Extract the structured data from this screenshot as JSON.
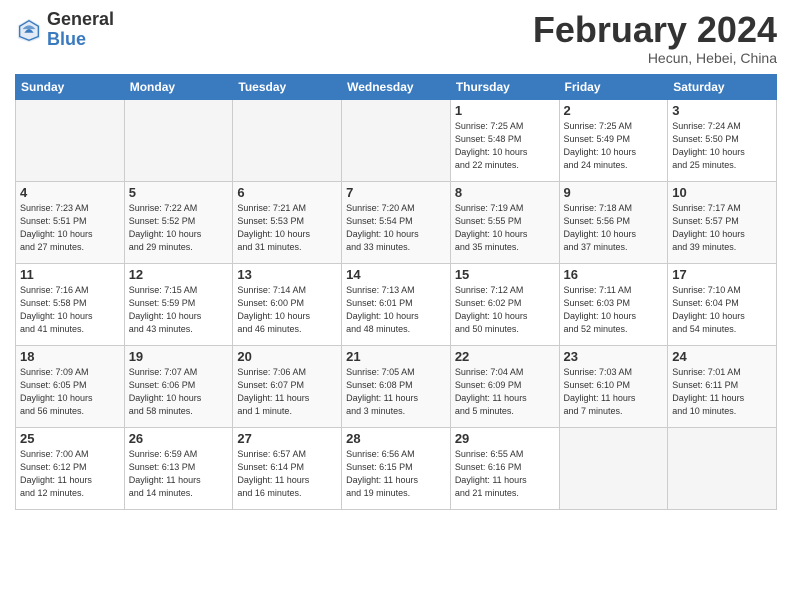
{
  "header": {
    "logo_general": "General",
    "logo_blue": "Blue",
    "title": "February 2024",
    "location": "Hecun, Hebei, China"
  },
  "days_of_week": [
    "Sunday",
    "Monday",
    "Tuesday",
    "Wednesday",
    "Thursday",
    "Friday",
    "Saturday"
  ],
  "weeks": [
    [
      {
        "num": "",
        "info": ""
      },
      {
        "num": "",
        "info": ""
      },
      {
        "num": "",
        "info": ""
      },
      {
        "num": "",
        "info": ""
      },
      {
        "num": "1",
        "info": "Sunrise: 7:25 AM\nSunset: 5:48 PM\nDaylight: 10 hours\nand 22 minutes."
      },
      {
        "num": "2",
        "info": "Sunrise: 7:25 AM\nSunset: 5:49 PM\nDaylight: 10 hours\nand 24 minutes."
      },
      {
        "num": "3",
        "info": "Sunrise: 7:24 AM\nSunset: 5:50 PM\nDaylight: 10 hours\nand 25 minutes."
      }
    ],
    [
      {
        "num": "4",
        "info": "Sunrise: 7:23 AM\nSunset: 5:51 PM\nDaylight: 10 hours\nand 27 minutes."
      },
      {
        "num": "5",
        "info": "Sunrise: 7:22 AM\nSunset: 5:52 PM\nDaylight: 10 hours\nand 29 minutes."
      },
      {
        "num": "6",
        "info": "Sunrise: 7:21 AM\nSunset: 5:53 PM\nDaylight: 10 hours\nand 31 minutes."
      },
      {
        "num": "7",
        "info": "Sunrise: 7:20 AM\nSunset: 5:54 PM\nDaylight: 10 hours\nand 33 minutes."
      },
      {
        "num": "8",
        "info": "Sunrise: 7:19 AM\nSunset: 5:55 PM\nDaylight: 10 hours\nand 35 minutes."
      },
      {
        "num": "9",
        "info": "Sunrise: 7:18 AM\nSunset: 5:56 PM\nDaylight: 10 hours\nand 37 minutes."
      },
      {
        "num": "10",
        "info": "Sunrise: 7:17 AM\nSunset: 5:57 PM\nDaylight: 10 hours\nand 39 minutes."
      }
    ],
    [
      {
        "num": "11",
        "info": "Sunrise: 7:16 AM\nSunset: 5:58 PM\nDaylight: 10 hours\nand 41 minutes."
      },
      {
        "num": "12",
        "info": "Sunrise: 7:15 AM\nSunset: 5:59 PM\nDaylight: 10 hours\nand 43 minutes."
      },
      {
        "num": "13",
        "info": "Sunrise: 7:14 AM\nSunset: 6:00 PM\nDaylight: 10 hours\nand 46 minutes."
      },
      {
        "num": "14",
        "info": "Sunrise: 7:13 AM\nSunset: 6:01 PM\nDaylight: 10 hours\nand 48 minutes."
      },
      {
        "num": "15",
        "info": "Sunrise: 7:12 AM\nSunset: 6:02 PM\nDaylight: 10 hours\nand 50 minutes."
      },
      {
        "num": "16",
        "info": "Sunrise: 7:11 AM\nSunset: 6:03 PM\nDaylight: 10 hours\nand 52 minutes."
      },
      {
        "num": "17",
        "info": "Sunrise: 7:10 AM\nSunset: 6:04 PM\nDaylight: 10 hours\nand 54 minutes."
      }
    ],
    [
      {
        "num": "18",
        "info": "Sunrise: 7:09 AM\nSunset: 6:05 PM\nDaylight: 10 hours\nand 56 minutes."
      },
      {
        "num": "19",
        "info": "Sunrise: 7:07 AM\nSunset: 6:06 PM\nDaylight: 10 hours\nand 58 minutes."
      },
      {
        "num": "20",
        "info": "Sunrise: 7:06 AM\nSunset: 6:07 PM\nDaylight: 11 hours\nand 1 minute."
      },
      {
        "num": "21",
        "info": "Sunrise: 7:05 AM\nSunset: 6:08 PM\nDaylight: 11 hours\nand 3 minutes."
      },
      {
        "num": "22",
        "info": "Sunrise: 7:04 AM\nSunset: 6:09 PM\nDaylight: 11 hours\nand 5 minutes."
      },
      {
        "num": "23",
        "info": "Sunrise: 7:03 AM\nSunset: 6:10 PM\nDaylight: 11 hours\nand 7 minutes."
      },
      {
        "num": "24",
        "info": "Sunrise: 7:01 AM\nSunset: 6:11 PM\nDaylight: 11 hours\nand 10 minutes."
      }
    ],
    [
      {
        "num": "25",
        "info": "Sunrise: 7:00 AM\nSunset: 6:12 PM\nDaylight: 11 hours\nand 12 minutes."
      },
      {
        "num": "26",
        "info": "Sunrise: 6:59 AM\nSunset: 6:13 PM\nDaylight: 11 hours\nand 14 minutes."
      },
      {
        "num": "27",
        "info": "Sunrise: 6:57 AM\nSunset: 6:14 PM\nDaylight: 11 hours\nand 16 minutes."
      },
      {
        "num": "28",
        "info": "Sunrise: 6:56 AM\nSunset: 6:15 PM\nDaylight: 11 hours\nand 19 minutes."
      },
      {
        "num": "29",
        "info": "Sunrise: 6:55 AM\nSunset: 6:16 PM\nDaylight: 11 hours\nand 21 minutes."
      },
      {
        "num": "",
        "info": ""
      },
      {
        "num": "",
        "info": ""
      }
    ]
  ]
}
